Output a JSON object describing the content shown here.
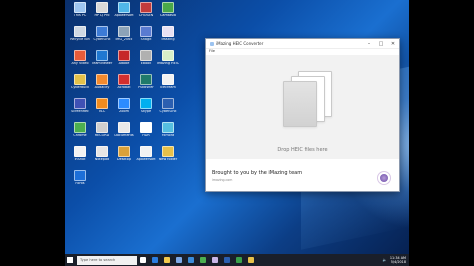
{
  "desktop": {
    "icons": [
      {
        "label": "This PC",
        "color": "#9fc6f0"
      },
      {
        "label": "HP LJ Pro",
        "color": "#d9d9d9"
      },
      {
        "label": "Apowersoft",
        "color": "#4fb6e8"
      },
      {
        "label": "CHOSEN",
        "color": "#c23b3b"
      },
      {
        "label": "Camtasia",
        "color": "#4aa84a"
      },
      {
        "label": "Recycle Bin",
        "color": "#cfd8e3"
      },
      {
        "label": "CyberLink",
        "color": "#3d7bd6"
      },
      {
        "label": "IMG_2065",
        "color": "#8ca3b8"
      },
      {
        "label": "Snagit",
        "color": "#5a7bd1"
      },
      {
        "label": "iMazing",
        "color": "#e8e1f3"
      },
      {
        "label": "Any Video",
        "color": "#e85c3a"
      },
      {
        "label": "TeamViewer",
        "color": "#1f78d1"
      },
      {
        "label": "Adobe",
        "color": "#c62828"
      },
      {
        "label": "Ebook",
        "color": "#b0b0b0"
      },
      {
        "label": "iMazing HEIC",
        "color": "#d8f0c8"
      },
      {
        "label": "Cyberduck",
        "color": "#e3c14a"
      },
      {
        "label": "Audacity",
        "color": "#f28a2e"
      },
      {
        "label": "Acrobat",
        "color": "#d32f2f"
      },
      {
        "label": "Publisher",
        "color": "#1f7a6a"
      },
      {
        "label": "Icecream",
        "color": "#f2f2f2"
      },
      {
        "label": "ScreenRec",
        "color": "#3f51b5"
      },
      {
        "label": "VLC",
        "color": "#f28c1e"
      },
      {
        "label": "Zoom",
        "color": "#2d8cff"
      },
      {
        "label": "Skype",
        "color": "#00aff0"
      },
      {
        "label": "CyberLink",
        "color": "#2b5fb0"
      },
      {
        "label": "Chrome",
        "color": "#4caf50"
      },
      {
        "label": "RECORD",
        "color": "#cfcfcf"
      },
      {
        "label": "Documents",
        "color": "#e9e9e9"
      },
      {
        "label": "HDR",
        "color": "#ffffff"
      },
      {
        "label": "Filmora",
        "color": "#56c0e0"
      },
      {
        "label": "InShot",
        "color": "#f2f2f2"
      },
      {
        "label": "Notepad",
        "color": "#e5e5e5"
      },
      {
        "label": "Desktop",
        "color": "#d9a13a"
      },
      {
        "label": "Apowersoft",
        "color": "#f2f2f2"
      },
      {
        "label": "New folder",
        "color": "#e7c14a"
      },
      {
        "label": "Fonts",
        "color": "#1d6fd8"
      }
    ]
  },
  "window": {
    "title": "iMazing HEIC Converter",
    "menu": "File",
    "drop_text": "Drop HEIC files here",
    "promo_title": "Brought to you by the iMazing team",
    "promo_sub": "imazing.com",
    "minimize": "–",
    "maximize": "□",
    "close": "✕"
  },
  "taskbar": {
    "search_placeholder": "Type here to search",
    "time": "11:34 AM",
    "date": "5/4/2018",
    "apps": [
      {
        "name": "task-view-icon",
        "color": "#ffffff"
      },
      {
        "name": "edge-icon",
        "color": "#2b7de0"
      },
      {
        "name": "file-explorer-icon",
        "color": "#f2c94c"
      },
      {
        "name": "store-icon",
        "color": "#7ea9e8"
      },
      {
        "name": "mail-icon",
        "color": "#3b8bd9"
      },
      {
        "name": "chrome-icon",
        "color": "#4caf50"
      },
      {
        "name": "imazing-icon",
        "color": "#c9b6e8"
      },
      {
        "name": "word-icon",
        "color": "#2b5fb0"
      },
      {
        "name": "camtasia-icon",
        "color": "#3aa14a"
      },
      {
        "name": "folder-icon",
        "color": "#e7c14a"
      }
    ]
  }
}
